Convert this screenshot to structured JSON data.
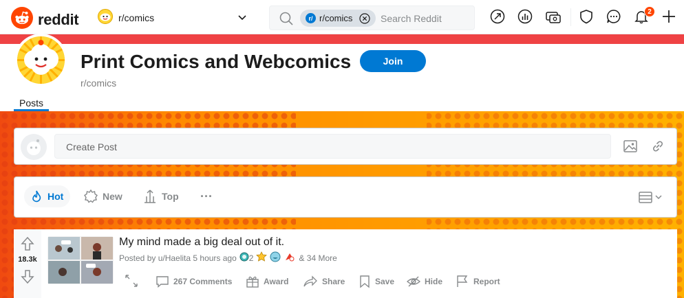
{
  "header": {
    "brand": "reddit",
    "community_switcher": "r/comics",
    "search": {
      "chip_prefix": "r/",
      "chip_label": "r/comics",
      "placeholder": "Search Reddit"
    },
    "notification_count": "2"
  },
  "community": {
    "title": "Print Comics and Webcomics",
    "name": "r/comics",
    "join_label": "Join",
    "tab": "Posts"
  },
  "create_post": {
    "placeholder": "Create Post"
  },
  "sort": {
    "hot": "Hot",
    "new": "New",
    "top": "Top",
    "more": "···"
  },
  "post": {
    "score": "18.3k",
    "title": "My mind made a big deal out of it.",
    "posted_by": "Posted by u/Haelita 5 hours ago",
    "award_count": "2",
    "more_awards": "& 34 More",
    "actions": {
      "comments": "267 Comments",
      "award": "Award",
      "share": "Share",
      "save": "Save",
      "hide": "Hide",
      "report": "Report"
    }
  },
  "colors": {
    "brand": "#ff4500",
    "accent": "#0079d3",
    "banner": "#ef4244",
    "background_orange": "#ff9d00"
  }
}
